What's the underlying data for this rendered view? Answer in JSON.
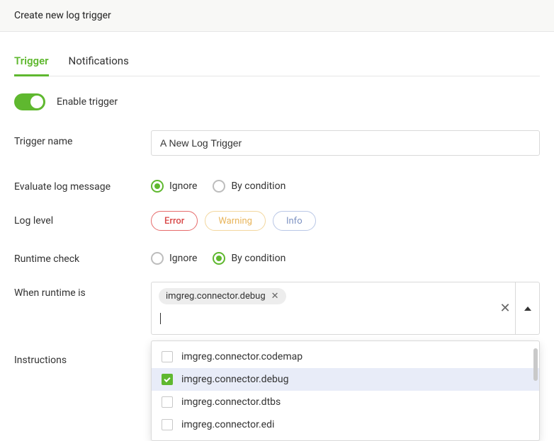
{
  "header": {
    "title": "Create new log trigger"
  },
  "tabs": [
    {
      "label": "Trigger",
      "active": true
    },
    {
      "label": "Notifications",
      "active": false
    }
  ],
  "enable": {
    "label": "Enable trigger",
    "on": true
  },
  "fields": {
    "triggerName": {
      "label": "Trigger name",
      "value": "A New Log Trigger"
    },
    "evaluateLog": {
      "label": "Evaluate log message",
      "options": [
        {
          "label": "Ignore",
          "checked": true
        },
        {
          "label": "By condition",
          "checked": false
        }
      ]
    },
    "logLevel": {
      "label": "Log level",
      "chips": [
        {
          "label": "Error",
          "kind": "error"
        },
        {
          "label": "Warning",
          "kind": "warning"
        },
        {
          "label": "Info",
          "kind": "info"
        }
      ]
    },
    "runtimeCheck": {
      "label": "Runtime check",
      "options": [
        {
          "label": "Ignore",
          "checked": false
        },
        {
          "label": "By condition",
          "checked": true
        }
      ]
    },
    "whenRuntime": {
      "label": "When runtime is",
      "tokens": [
        {
          "label": "imgreg.connector.debug"
        }
      ],
      "dropdown": [
        {
          "label": "imgreg.connector.codemap",
          "checked": false,
          "highlight": false
        },
        {
          "label": "imgreg.connector.debug",
          "checked": true,
          "highlight": true
        },
        {
          "label": "imgreg.connector.dtbs",
          "checked": false,
          "highlight": false
        },
        {
          "label": "imgreg.connector.edi",
          "checked": false,
          "highlight": false
        }
      ]
    },
    "instructions": {
      "label": "Instructions"
    }
  }
}
